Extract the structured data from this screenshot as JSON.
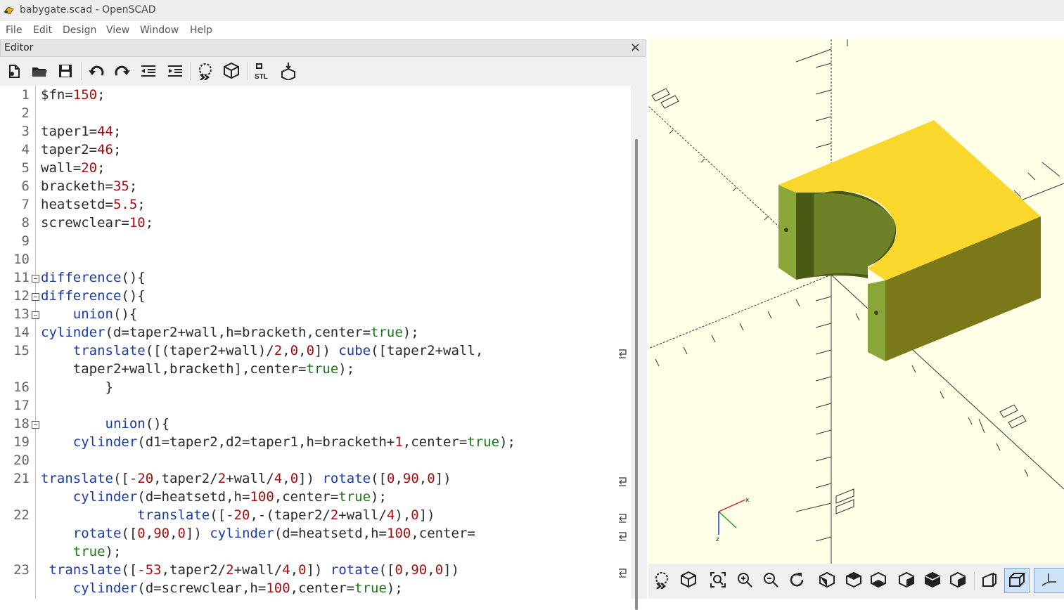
{
  "window": {
    "title": "babygate.scad - OpenSCAD",
    "app_icon": "openscad-icon"
  },
  "menu": [
    "File",
    "Edit",
    "Design",
    "View",
    "Window",
    "Help"
  ],
  "editor": {
    "title": "Editor",
    "close_symbol": "×",
    "toolbar": [
      "new-file-icon",
      "open-file-icon",
      "save-icon",
      "undo-icon",
      "redo-icon",
      "unindent-icon",
      "indent-icon",
      "preview-icon",
      "render-icon",
      "export-stl-icon",
      "send-to-print-icon"
    ],
    "line_numbers": [
      "1",
      "2",
      "3",
      "4",
      "5",
      "6",
      "7",
      "8",
      "9",
      "10",
      "11",
      "12",
      "13",
      "14",
      "15",
      "",
      "16",
      "17",
      "18",
      "19",
      "20",
      "21",
      "",
      "22",
      "",
      "",
      "23",
      ""
    ]
  },
  "code_lines": [
    "$fn=150;",
    "",
    "taper1=44;",
    "taper2=46;",
    "wall=20;",
    "bracketh=35;",
    "heatsetd=5.5;",
    "screwclear=10;",
    "",
    "",
    "difference(){",
    "difference(){",
    "    union(){",
    "cylinder(d=taper2+wall,h=bracketh,center=true);",
    "    translate([(taper2+wall)/2,0,0]) cube([taper2+wall,",
    "    taper2+wall,bracketh],center=true);",
    "        }",
    "",
    "        union(){",
    "    cylinder(d1=taper2,d2=taper1,h=bracketh+1,center=true);",
    "",
    "translate([-20,taper2/2+wall/4,0]) rotate([0,90,0])",
    "    cylinder(d=heatsetd,h=100,center=true);",
    "            translate([-20,-(taper2/2+wall/4),0])",
    "    rotate([0,90,0]) cylinder(d=heatsetd,h=100,center=",
    "    true);",
    " translate([-53,taper2/2+wall/4,0]) rotate([0,90,0])",
    "    cylinder(d=screwclear,h=100,center=true);"
  ],
  "view3d": {
    "background": "#fffee6",
    "model_top_color": "#f9d72c",
    "model_side_color": "#7a8c2a",
    "axis_labels": {
      "x": "x",
      "z": "z"
    }
  },
  "view_toolbar": [
    "preview-icon",
    "render-icon",
    "view-all-icon",
    "zoom-in-icon",
    "zoom-out-icon",
    "reset-view-icon",
    "view-right-icon",
    "view-top-icon",
    "view-bottom-icon",
    "view-left-icon",
    "view-front-icon",
    "view-back-icon",
    "perspective-icon",
    "orthogonal-icon",
    "show-axes-icon"
  ]
}
